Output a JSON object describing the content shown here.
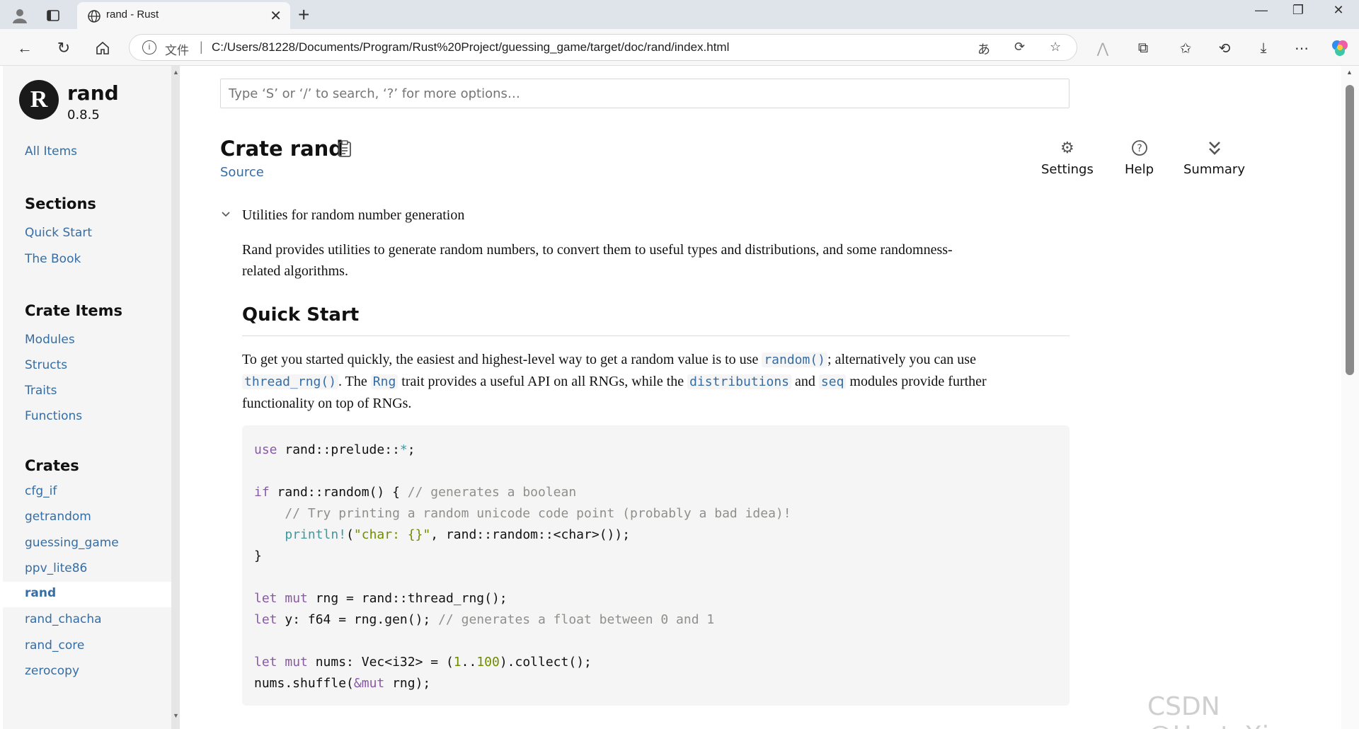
{
  "browser": {
    "tab_title": "rand - Rust",
    "address_label": "文件",
    "url": "C:/Users/81228/Documents/Program/Rust%20Project/guessing_game/target/doc/rand/index.html"
  },
  "sidebar": {
    "crate_name": "rand",
    "crate_version": "0.8.5",
    "all_items": "All Items",
    "sections_heading": "Sections",
    "sections": [
      "Quick Start",
      "The Book"
    ],
    "crate_items_heading": "Crate Items",
    "crate_items": [
      "Modules",
      "Structs",
      "Traits",
      "Functions"
    ],
    "crates_heading": "Crates",
    "crates": [
      "cfg_if",
      "getrandom",
      "guessing_game",
      "ppv_lite86",
      "rand",
      "rand_chacha",
      "rand_core",
      "zerocopy"
    ],
    "current_crate": "rand"
  },
  "main": {
    "search_placeholder": "Type ‘S’ or ‘/’ to search, ‘?’ for more options…",
    "title": "Crate rand",
    "source_link": "Source",
    "settings_label": "Settings",
    "help_label": "Help",
    "summary_label": "Summary",
    "summary_line": "Utilities for random number generation",
    "intro_line1": "Rand provides utilities to generate random numbers, to convert them to useful types and distributions, and some randomness-",
    "intro_line2": "related algorithms.",
    "quick_start_heading": "Quick Start",
    "qs_text1": "To get you started quickly, the easiest and highest-level way to get a random value is to use ",
    "qs_link_random": "random()",
    "qs_text2": "; alternatively you can use",
    "qs_link_thread_rng": "thread_rng()",
    "qs_text3": ". The ",
    "qs_link_rng": "Rng",
    "qs_text4": " trait provides a useful API on all RNGs, while the ",
    "qs_link_distributions": "distributions",
    "qs_text5": " and ",
    "qs_link_seq": "seq",
    "qs_text6": " modules provide further",
    "qs_text7": "functionality on top of RNGs."
  },
  "watermark": "CSDN @UestcXiye"
}
